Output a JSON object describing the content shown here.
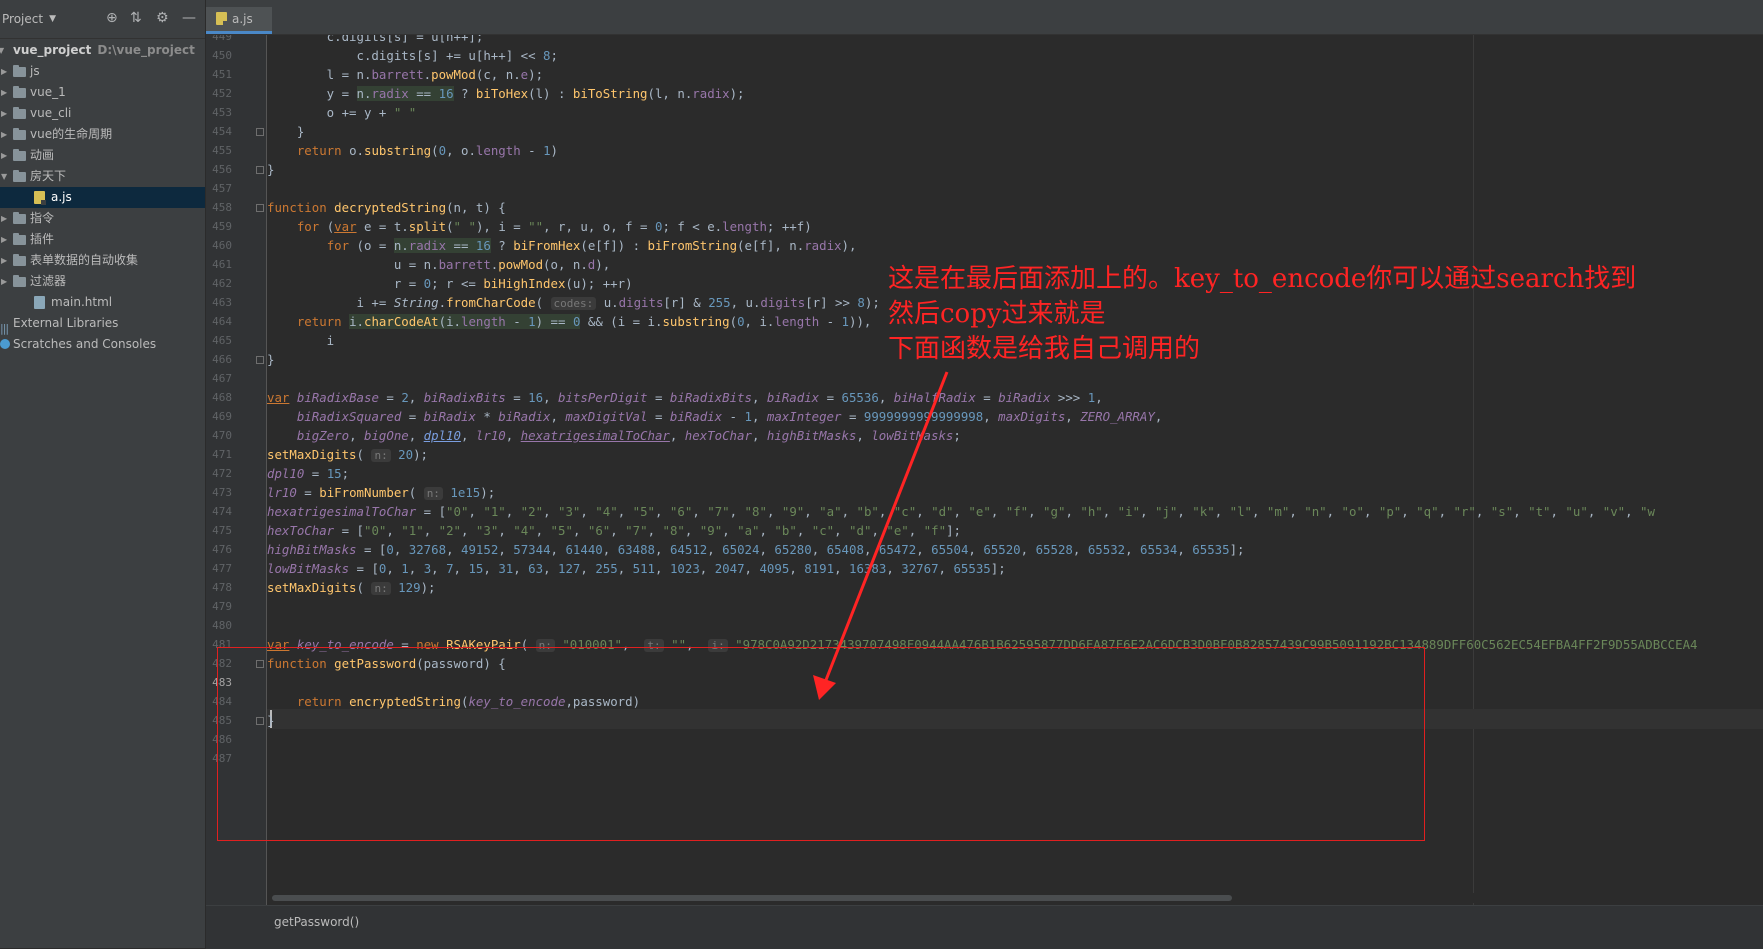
{
  "project_panel": {
    "title": "Project",
    "tree": [
      {
        "label": "vue_project",
        "path": "D:\\vue_project",
        "kind": "root",
        "depth": 0
      },
      {
        "label": "js",
        "kind": "folder",
        "depth": 1
      },
      {
        "label": "vue_1",
        "kind": "folder",
        "depth": 1
      },
      {
        "label": "vue_cli",
        "kind": "folder",
        "depth": 1
      },
      {
        "label": "vue的生命周期",
        "kind": "folder",
        "depth": 1
      },
      {
        "label": "动画",
        "kind": "folder",
        "depth": 1
      },
      {
        "label": "房天下",
        "kind": "folder",
        "depth": 1
      },
      {
        "label": "a.js",
        "kind": "js",
        "depth": 2,
        "selected": true
      },
      {
        "label": "指令",
        "kind": "folder",
        "depth": 1
      },
      {
        "label": "插件",
        "kind": "folder",
        "depth": 1
      },
      {
        "label": "表单数据的自动收集",
        "kind": "folder",
        "depth": 1
      },
      {
        "label": "过滤器",
        "kind": "folder",
        "depth": 1
      },
      {
        "label": "main.html",
        "kind": "html",
        "depth": 2
      },
      {
        "label": "External Libraries",
        "kind": "libs",
        "depth": 0
      },
      {
        "label": "Scratches and Consoles",
        "kind": "scratch",
        "depth": 0
      }
    ]
  },
  "editor": {
    "tab_label": "a.js",
    "line_numbers": [
      "449",
      "450",
      "451",
      "452",
      "453",
      "454",
      "455",
      "456",
      "457",
      "458",
      "459",
      "460",
      "461",
      "462",
      "463",
      "464",
      "465",
      "466",
      "467",
      "468",
      "469",
      "470",
      "471",
      "472",
      "473",
      "474",
      "475",
      "476",
      "477",
      "478",
      "479",
      "480",
      "481",
      "482",
      "483",
      "484",
      "485",
      "486",
      "487"
    ],
    "current_line": "483",
    "fold_lines": [
      "454",
      "456",
      "458",
      "466",
      "482",
      "485"
    ],
    "hint_labels": {
      "codes": "codes:",
      "n": "n:",
      "t": "t:",
      "i": "i:"
    }
  },
  "annotation": {
    "lines": [
      "这是在最后面添加上的。key_to_encode你可以通过search找到",
      "然后copy过来就是",
      "下面函数是给我自己调用的"
    ],
    "color": "#ff2424"
  },
  "breadcrumb": "getPassword()",
  "colors": {
    "keyword": "#cc7832",
    "function": "#ffc66d",
    "property": "#9876aa",
    "number": "#6897bb",
    "string": "#6a8759",
    "text": "#a9b7c6",
    "selection": "#0d293e"
  }
}
